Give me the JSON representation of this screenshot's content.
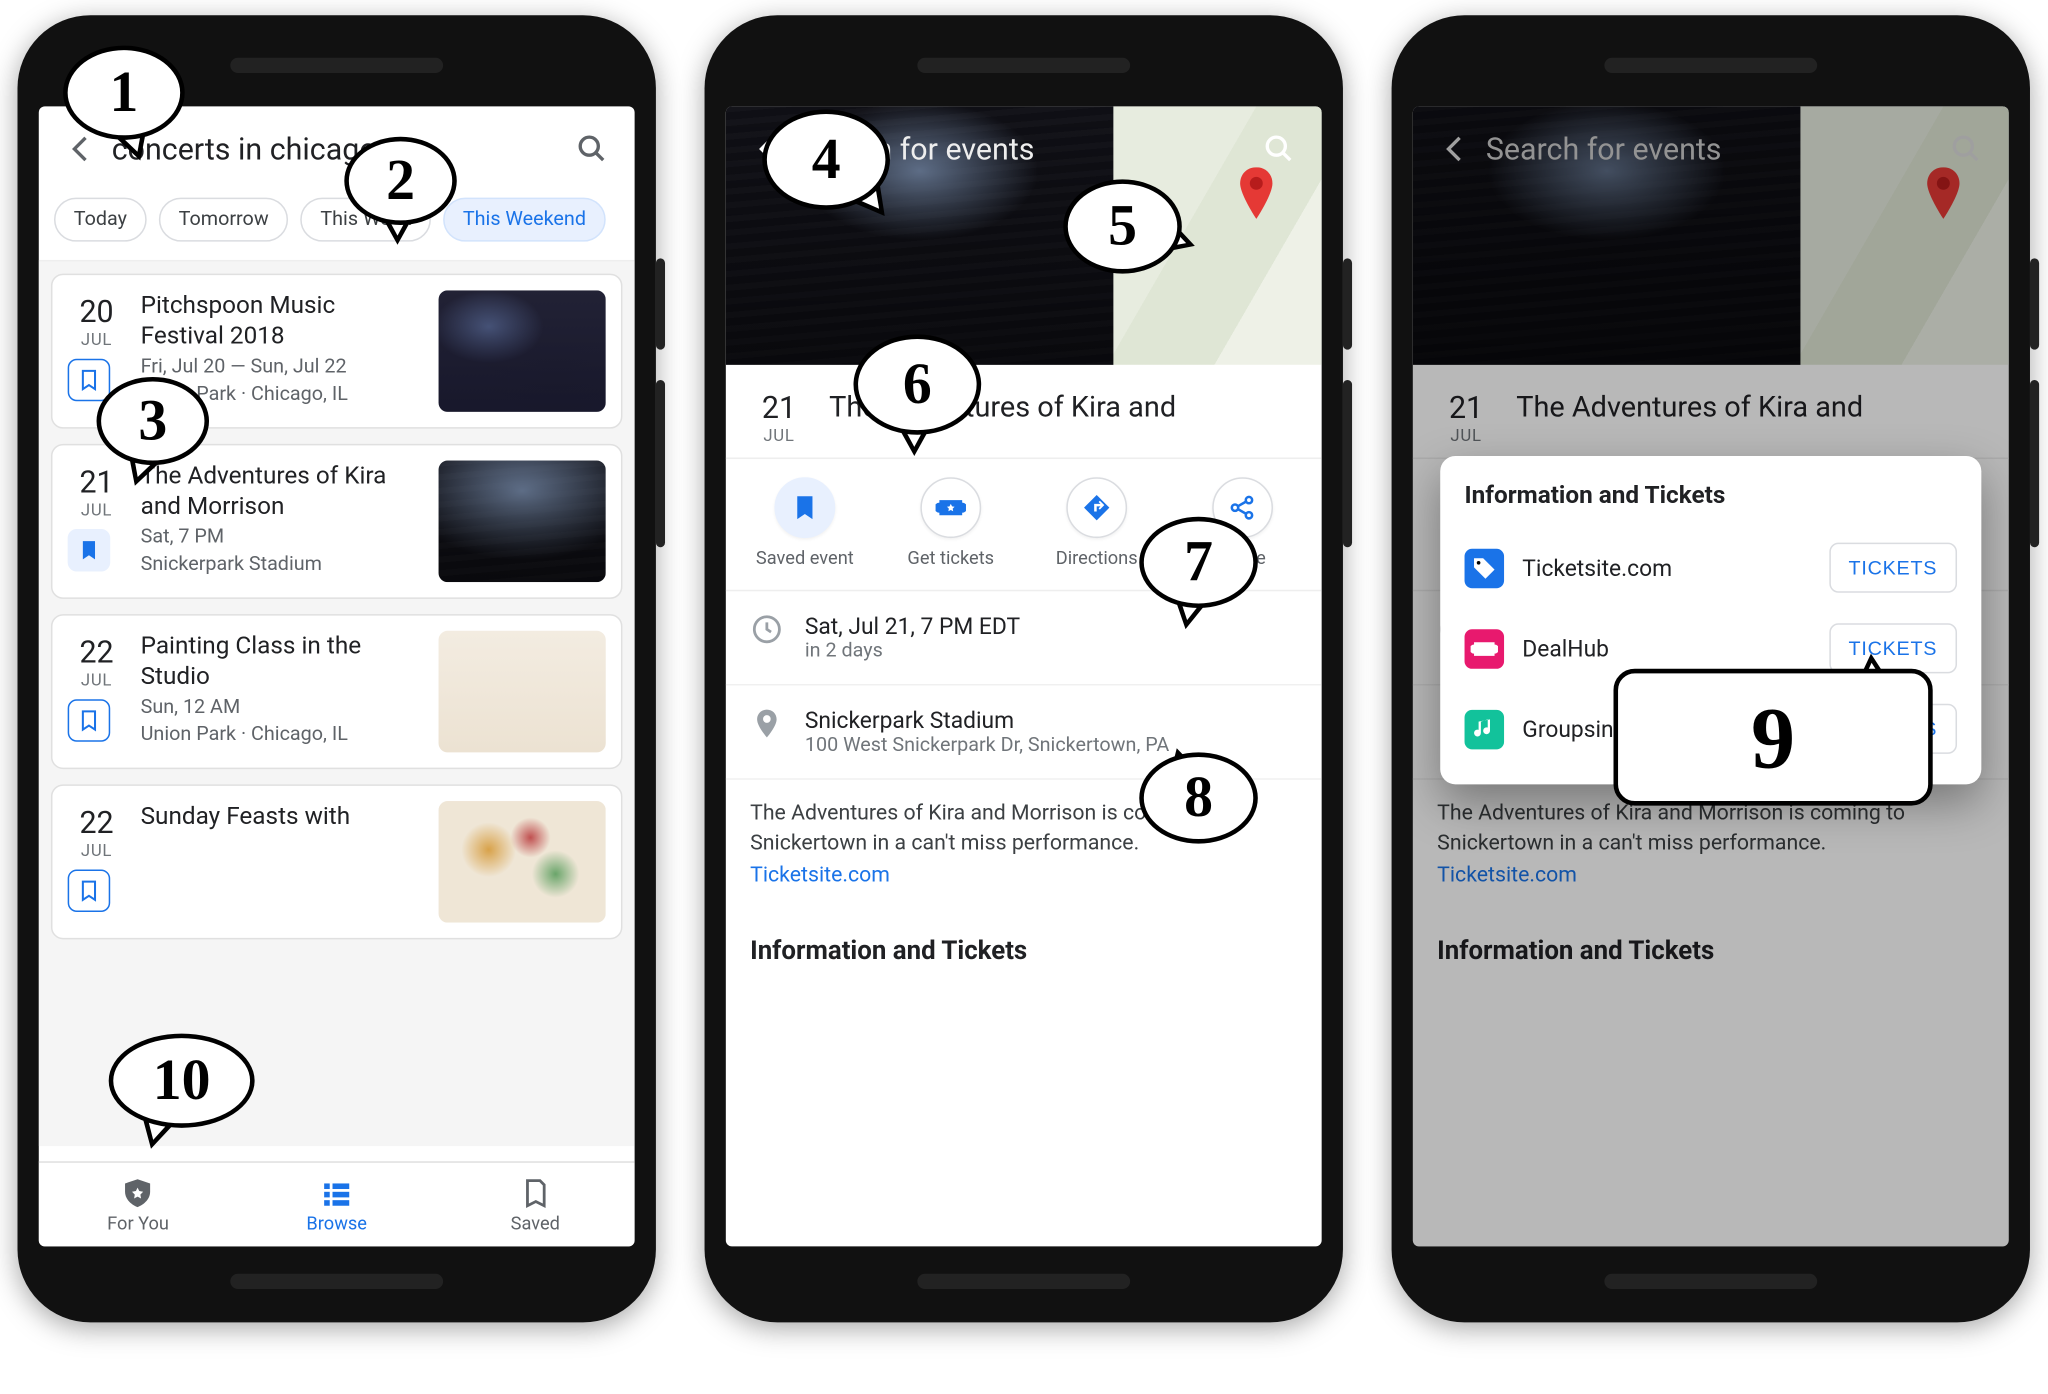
{
  "p1": {
    "search_query": "concerts in chicago",
    "chips": [
      "Today",
      "Tomorrow",
      "This Week",
      "This Weekend"
    ],
    "active_chip": 3,
    "events": [
      {
        "day": "20",
        "mon": "JUL",
        "title": "Pitchspoon Music Festival 2018",
        "sub1": "Fri, Jul 20 — Sun, Jul 22",
        "sub2": "Union Park · Chicago, IL",
        "saved": false,
        "art": "art-concert"
      },
      {
        "day": "21",
        "mon": "JUL",
        "title": "The Adventures of Kira and Morrison",
        "sub1": "Sat, 7 PM",
        "sub2": "Snickerpark Stadium",
        "saved": true,
        "art": "art-stage"
      },
      {
        "day": "22",
        "mon": "JUL",
        "title": "Painting Class in the Studio",
        "sub1": "Sun, 12 AM",
        "sub2": "Union Park · Chicago, IL",
        "saved": false,
        "art": "art-paint"
      },
      {
        "day": "22",
        "mon": "JUL",
        "title": "Sunday Feasts with",
        "sub1": "",
        "sub2": "",
        "saved": false,
        "art": "art-food"
      }
    ],
    "nav": {
      "for_you": "For You",
      "browse": "Browse",
      "saved": "Saved"
    }
  },
  "p2": {
    "search_placeholder": "Search for events",
    "day": "21",
    "mon": "JUL",
    "title_line": "The Adventures of Kira and",
    "actions": {
      "saved": "Saved event",
      "tickets": "Get tickets",
      "directions": "Directions",
      "share": "Share"
    },
    "time_line": "Sat, Jul 21, 7 PM EDT",
    "time_sub": "in 2 days",
    "venue": "Snickerpark Stadium",
    "address": "100 West Snickerpark Dr, Snickertown, PA",
    "desc": "The Adventures of Kira and Morrison is coming to Snickertown in a can't miss performance.",
    "desc_link": "Ticketsite.com",
    "section": "Information and Tickets"
  },
  "p3": {
    "search_placeholder": "Search for events",
    "modal_title": "Information and Tickets",
    "button": "TICKETS",
    "providers": [
      {
        "name": "Ticketsite.com",
        "color": "#1a73e8",
        "shape": "tag"
      },
      {
        "name": "DealHub",
        "color": "#e8196e",
        "shape": "ticket"
      },
      {
        "name": "Groupsintown",
        "color": "#12c29b",
        "shape": "note"
      }
    ]
  },
  "callouts": [
    "1",
    "2",
    "3",
    "4",
    "5",
    "6",
    "7",
    "8",
    "9",
    "10"
  ]
}
